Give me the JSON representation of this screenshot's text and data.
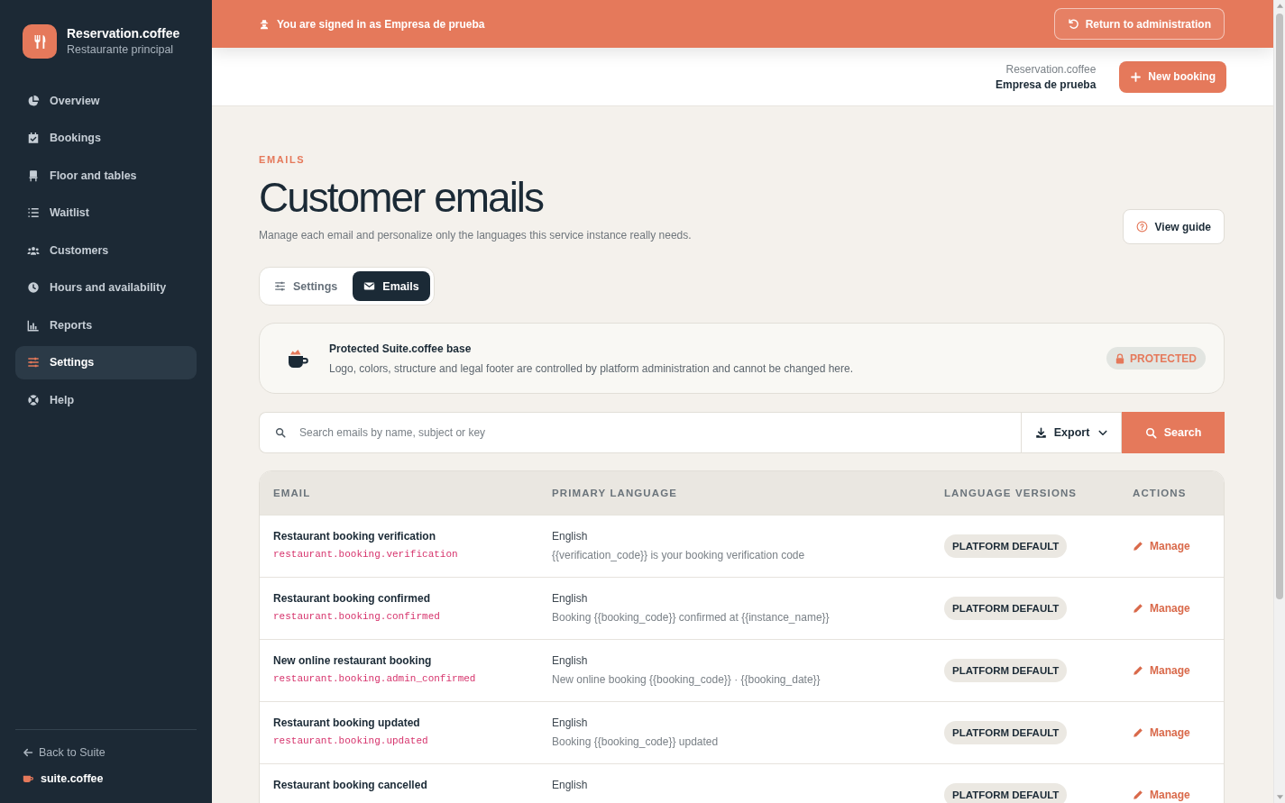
{
  "sidebar": {
    "brand": {
      "name": "Reservation.coffee",
      "subtitle": "Restaurante principal"
    },
    "items": [
      {
        "label": "Overview",
        "selected": false
      },
      {
        "label": "Bookings",
        "selected": false
      },
      {
        "label": "Floor and tables",
        "selected": false
      },
      {
        "label": "Waitlist",
        "selected": false
      },
      {
        "label": "Customers",
        "selected": false
      },
      {
        "label": "Hours and availability",
        "selected": false
      },
      {
        "label": "Reports",
        "selected": false
      },
      {
        "label": "Settings",
        "selected": true
      },
      {
        "label": "Help",
        "selected": false
      }
    ],
    "back_link": "Back to Suite",
    "footer_brand": "suite.coffee"
  },
  "banner": {
    "text": "You are signed in as Empresa de prueba",
    "button": "Return to administration"
  },
  "header": {
    "product": "Reservation.coffee",
    "account": "Empresa de prueba",
    "button": "New booking"
  },
  "page": {
    "eyebrow": "EMAILS",
    "title": "Customer emails",
    "subtitle": "Manage each email and personalize only the languages this service instance really needs.",
    "guide_button": "View guide"
  },
  "tabs": [
    {
      "label": "Settings",
      "selected": false
    },
    {
      "label": "Emails",
      "selected": true
    }
  ],
  "notice": {
    "title": "Protected Suite.coffee base",
    "text": "Logo, colors, structure and legal footer are controlled by platform administration and cannot be changed here.",
    "badge": "PROTECTED"
  },
  "search": {
    "placeholder": "Search emails by name, subject or key",
    "export_button": "Export",
    "search_button": "Search"
  },
  "table": {
    "columns": [
      "EMAIL",
      "PRIMARY LANGUAGE",
      "LANGUAGE VERSIONS",
      "ACTIONS"
    ],
    "rows": [
      {
        "name": "Restaurant booking verification",
        "key": "restaurant.booking.verification",
        "language": "English",
        "subject": "{{verification_code}} is your booking verification code",
        "versions": "PLATFORM DEFAULT",
        "action": "Manage"
      },
      {
        "name": "Restaurant booking confirmed",
        "key": "restaurant.booking.confirmed",
        "language": "English",
        "subject": "Booking {{booking_code}} confirmed at {{instance_name}}",
        "versions": "PLATFORM DEFAULT",
        "action": "Manage"
      },
      {
        "name": "New online restaurant booking",
        "key": "restaurant.booking.admin_confirmed",
        "language": "English",
        "subject": "New online booking {{booking_code}} · {{booking_date}}",
        "versions": "PLATFORM DEFAULT",
        "action": "Manage"
      },
      {
        "name": "Restaurant booking updated",
        "key": "restaurant.booking.updated",
        "language": "English",
        "subject": "Booking {{booking_code}} updated",
        "versions": "PLATFORM DEFAULT",
        "action": "Manage"
      },
      {
        "name": "Restaurant booking cancelled",
        "language": "English",
        "versions": "PLATFORM DEFAULT",
        "action": "Manage"
      }
    ]
  }
}
